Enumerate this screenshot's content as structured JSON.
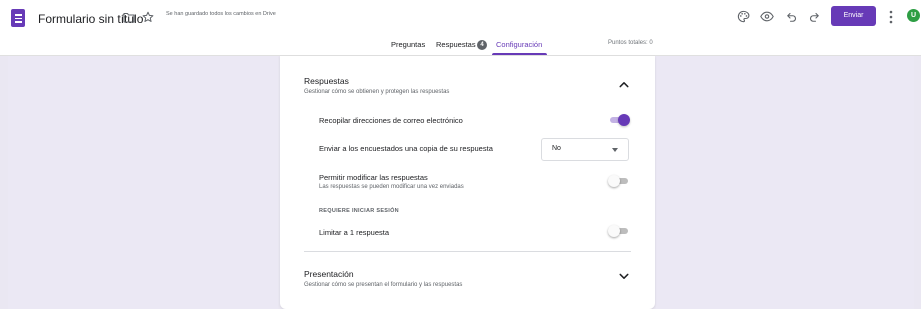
{
  "header": {
    "title": "Formulario sin título",
    "saved_status": "Se han guardado todos los cambios en Drive",
    "send_label": "Enviar",
    "avatar_letter": "U",
    "icons": [
      "forms-logo-icon",
      "folder-icon",
      "star-icon",
      "palette-icon",
      "preview-eye-icon",
      "undo-icon",
      "redo-icon",
      "more-vert-icon"
    ]
  },
  "tabs": {
    "questions": "Preguntas",
    "responses": "Respuestas",
    "responses_count": "4",
    "settings": "Configuración",
    "active": "Configuración",
    "total_points": "Puntos totales: 0"
  },
  "responses_section": {
    "title": "Respuestas",
    "subtitle": "Gestionar cómo se obtienen y protegen las respuestas",
    "expanded": true,
    "collect_emails": {
      "label": "Recopilar direcciones de correo electrónico",
      "on": true
    },
    "send_copy": {
      "label": "Enviar a los encuestados una copia de su respuesta",
      "value": "No"
    },
    "allow_edit": {
      "label": "Permitir modificar las respuestas",
      "sublabel": "Las respuestas se pueden modificar una vez enviadas",
      "on": false
    },
    "requires_signin": "REQUIERE INICIAR SESIÓN",
    "limit_one": {
      "label": "Limitar a 1 respuesta",
      "on": false
    }
  },
  "presentation_section": {
    "title": "Presentación",
    "subtitle": "Gestionar cómo se presentan el formulario y las respuestas",
    "expanded": false
  },
  "colors": {
    "accent": "#673ab7",
    "background": "#eae7f2",
    "avatar": "#2e9e44"
  }
}
